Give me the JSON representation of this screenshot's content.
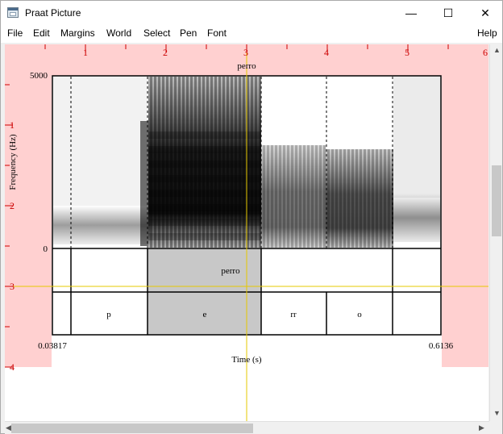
{
  "window": {
    "title": "Praat Picture",
    "minimize": "—",
    "maximize": "☐",
    "close": "✕"
  },
  "menu": {
    "items": [
      "File",
      "Edit",
      "Margins",
      "World",
      "Select",
      "Pen",
      "Font"
    ],
    "help": "Help"
  },
  "ruler": {
    "top": [
      "1",
      "2",
      "3",
      "4",
      "5",
      "6"
    ],
    "left": [
      "1",
      "2",
      "3",
      "4"
    ],
    "color": "#cc0000",
    "selection_color": "#ffd0d0",
    "crosshair_color": "#e6c800"
  },
  "picture": {
    "title": "perro",
    "ylabel": "Frequency (Hz)",
    "xlabel": "Time (s)",
    "y_max": "5000",
    "y_min": "0",
    "x_start": "0.03817",
    "x_end": "0.6136",
    "tiers": [
      {
        "intervals": [
          {
            "label": "perro",
            "highlighted": true
          }
        ]
      },
      {
        "intervals": [
          {
            "label": "p",
            "highlighted": false
          },
          {
            "label": "e",
            "highlighted": true
          },
          {
            "label": "rr",
            "highlighted": false
          },
          {
            "label": "o",
            "highlighted": false
          }
        ]
      }
    ]
  }
}
